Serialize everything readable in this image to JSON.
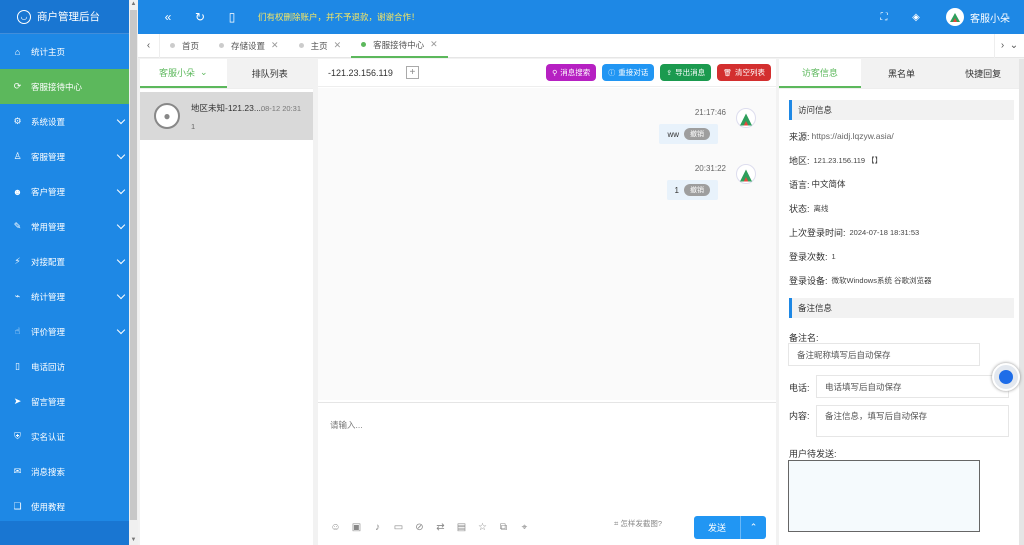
{
  "brand": {
    "title": "商户管理后台"
  },
  "sidebar": {
    "items": [
      {
        "label": "统计主页",
        "icon": "home-icon",
        "expandable": false,
        "active": false
      },
      {
        "label": "客服接待中心",
        "icon": "refresh-icon",
        "expandable": false,
        "active": true
      },
      {
        "label": "系统设置",
        "icon": "gear-icon",
        "expandable": true,
        "active": false
      },
      {
        "label": "客服管理",
        "icon": "user-icon",
        "expandable": true,
        "active": false
      },
      {
        "label": "客户管理",
        "icon": "user-group-icon",
        "expandable": true,
        "active": false
      },
      {
        "label": "常用管理",
        "icon": "edit-icon",
        "expandable": true,
        "active": false
      },
      {
        "label": "对接配置",
        "icon": "plug-icon",
        "expandable": true,
        "active": false
      },
      {
        "label": "统计管理",
        "icon": "chart-icon",
        "expandable": true,
        "active": false
      },
      {
        "label": "评价管理",
        "icon": "thumbs-up-icon",
        "expandable": true,
        "active": false
      },
      {
        "label": "电话回访",
        "icon": "phone-icon",
        "expandable": false,
        "active": false
      },
      {
        "label": "留言管理",
        "icon": "send-icon",
        "expandable": false,
        "active": false
      },
      {
        "label": "实名认证",
        "icon": "shield-icon",
        "expandable": false,
        "active": false
      },
      {
        "label": "消息搜索",
        "icon": "message-icon",
        "expandable": false,
        "active": false
      },
      {
        "label": "使用教程",
        "icon": "book-icon",
        "expandable": false,
        "active": false
      }
    ]
  },
  "topbar": {
    "notice": "们有权删除账户，并不予退款，谢谢合作！",
    "username": "客服小朵"
  },
  "tabs": [
    {
      "label": "首页",
      "active": false
    },
    {
      "label": "存储设置",
      "active": false
    },
    {
      "label": "主页",
      "active": false
    },
    {
      "label": "客服接待中心",
      "active": true
    }
  ],
  "left_panel": {
    "tab_agent": "客服小朵",
    "tab_queue": "排队列表",
    "conversation": {
      "name": "地区未知-121.23....",
      "time": "08-12 20:31",
      "preview": "1"
    }
  },
  "chat": {
    "header_ip": "-121.23.156.119",
    "buttons": [
      {
        "label": "消息搜索",
        "color": "#b620c2",
        "icon": "search-icon"
      },
      {
        "label": "重接对话",
        "color": "#2196f3",
        "icon": "info-icon"
      },
      {
        "label": "导出消息",
        "color": "#1b9a4f",
        "icon": "export-icon"
      },
      {
        "label": "清空列表",
        "color": "#d32f2f",
        "icon": "trash-icon"
      }
    ],
    "messages": [
      {
        "time": "21:17:46",
        "text": "ww",
        "recall": "撤销"
      },
      {
        "time": "20:31:22",
        "text": "1",
        "recall": "撤销"
      }
    ],
    "input_placeholder": "请输入...",
    "screenshot_tip": "怎样发截图?",
    "send_label": "发送"
  },
  "right_panel": {
    "tabs": [
      "访客信息",
      "黑名单",
      "快捷回复"
    ],
    "visit_section": "访问信息",
    "source_label": "来源:",
    "source_value": "https://aidj.lqzyw.asia/",
    "region_label": "地区:",
    "region_value": "121.23.156.119 【】",
    "lang_label": "语言:",
    "lang_value": "中文简体",
    "status_label": "状态:",
    "status_value": "离线",
    "last_login_label": "上次登录时间:",
    "last_login_value": "2024-07-18 18:31:53",
    "login_count_label": "登录次数:",
    "login_count_value": "1",
    "device_label": "登录设备:",
    "device_value": "微软Windows系统 谷歌浏览器",
    "note_section": "备注信息",
    "note_name_label": "备注名:",
    "note_name_placeholder": "备注昵称填写后自动保存",
    "phone_label": "电话:",
    "phone_placeholder": "电话填写后自动保存",
    "content_label": "内容:",
    "content_placeholder": "备注信息，填写后自动保存",
    "pending_label": "用户待发送:"
  }
}
